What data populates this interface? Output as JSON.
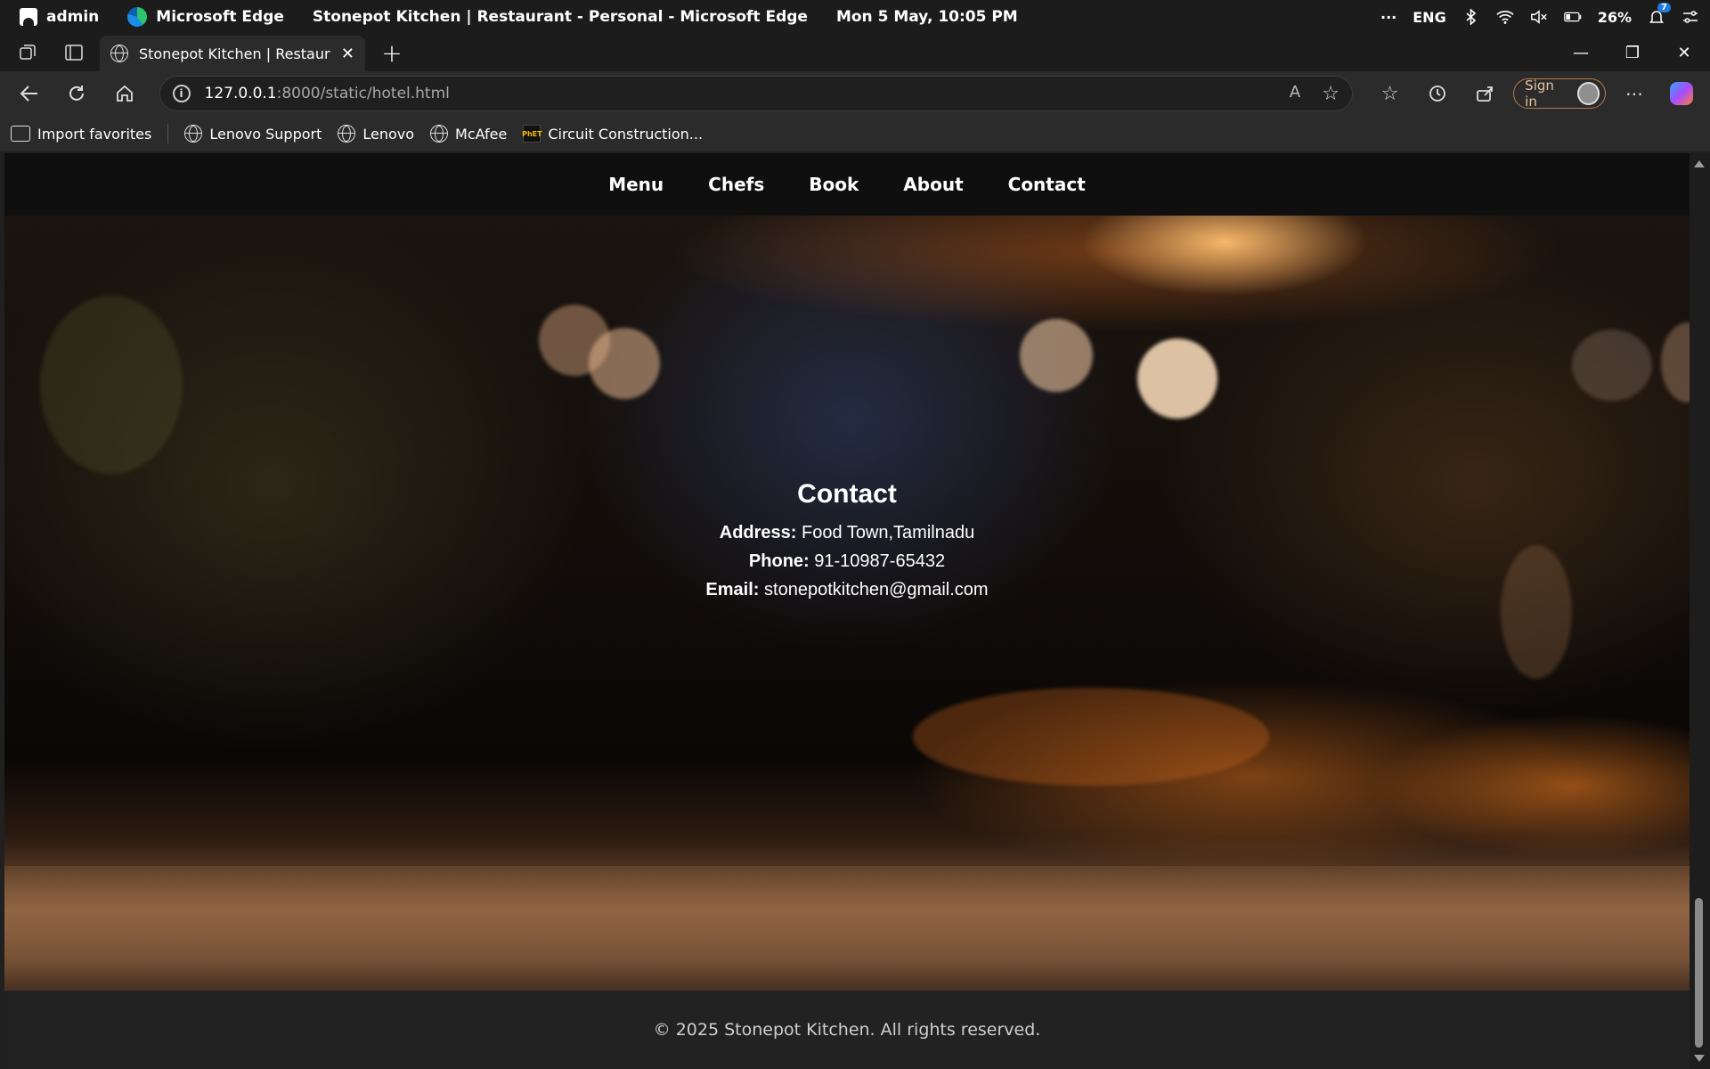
{
  "os": {
    "user": "admin",
    "app_name": "Microsoft Edge",
    "window_title": "Stonepot Kitchen | Restaurant - Personal - Microsoft Edge",
    "datetime": "Mon 5 May, 10:05 PM",
    "more": "···",
    "language": "ENG",
    "battery": "26%",
    "notification_count": "7"
  },
  "browser": {
    "tab_title": "Stonepot Kitchen | Restaurant",
    "url_host": "127.0.0.1",
    "url_path": ":8000/static/hotel.html",
    "sign_in_label": "Sign in",
    "favorites": [
      {
        "label": "Import favorites"
      },
      {
        "label": "Lenovo Support"
      },
      {
        "label": "Lenovo"
      },
      {
        "label": "McAfee"
      },
      {
        "label": "Circuit Construction..."
      }
    ]
  },
  "site": {
    "nav": [
      {
        "label": "Menu"
      },
      {
        "label": "Chefs"
      },
      {
        "label": "Book"
      },
      {
        "label": "About"
      },
      {
        "label": "Contact"
      }
    ],
    "contact": {
      "heading": "Contact",
      "address_label": "Address:",
      "address_value": "Food Town,Tamilnadu",
      "phone_label": "Phone:",
      "phone_value": "91-10987-65432",
      "email_label": "Email:",
      "email_value": "stonepotkitchen@gmail.com"
    },
    "footer": "© 2025 Stonepot Kitchen. All rights reserved."
  }
}
